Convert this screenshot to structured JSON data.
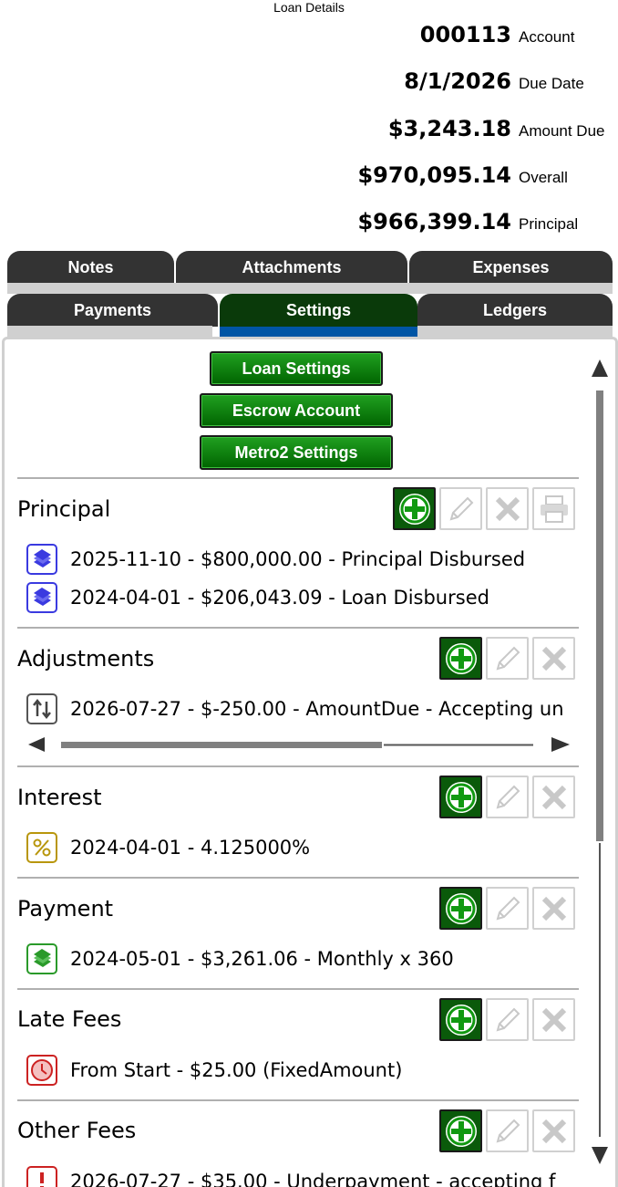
{
  "window": {
    "title": "Loan Details"
  },
  "summary": [
    {
      "value": "000113",
      "label": "Account"
    },
    {
      "value": "8/1/2026",
      "label": "Due Date"
    },
    {
      "value": "$3,243.18",
      "label": "Amount Due"
    },
    {
      "value": "$970,095.14",
      "label": "Overall"
    },
    {
      "value": "$966,399.14",
      "label": "Principal"
    }
  ],
  "tabs_row1": [
    "Notes",
    "Attachments",
    "Expenses"
  ],
  "tabs_row2": [
    "Payments",
    "Settings",
    "Ledgers"
  ],
  "active_tab": "Settings",
  "settings_buttons": [
    "Loan Settings",
    "Escrow Account",
    "Metro2 Settings"
  ],
  "sections": {
    "principal": {
      "title": "Principal",
      "items": [
        "2025-11-10 - $800,000.00 - Principal Disbursed",
        "2024-04-01 - $206,043.09 - Loan Disbursed"
      ]
    },
    "adjustments": {
      "title": "Adjustments",
      "items": [
        "2026-07-27 - $-250.00 - AmountDue - Accepting un"
      ]
    },
    "interest": {
      "title": "Interest",
      "items": [
        "2024-04-01 - 4.125000%"
      ]
    },
    "payment": {
      "title": "Payment",
      "items": [
        "2024-05-01 - $3,261.06 - Monthly x 360"
      ]
    },
    "late_fees": {
      "title": "Late Fees",
      "items": [
        "From Start - $25.00 (FixedAmount)"
      ]
    },
    "other_fees": {
      "title": "Other Fees",
      "items": [
        "2026-07-27 - $35.00 - Underpayment - accepting f"
      ]
    }
  },
  "colors": {
    "tab_bg": "#333333",
    "tab_active_bg": "#0a3a0a",
    "tab_active_indicator": "#0055a5",
    "green_button": "#006400",
    "principal_icon": "#3a3ae0",
    "adjust_icon": "#555555",
    "interest_icon": "#b8960c",
    "payment_icon": "#2a9a2a",
    "latefee_icon": "#cc2222"
  },
  "icons": {
    "principal_item": "money-stack-icon",
    "adjust_item": "up-down-arrows-icon",
    "interest_item": "percent-icon",
    "payment_item": "cash-icon",
    "latefee_item": "clock-icon",
    "otherfee_item": "alert-icon"
  }
}
